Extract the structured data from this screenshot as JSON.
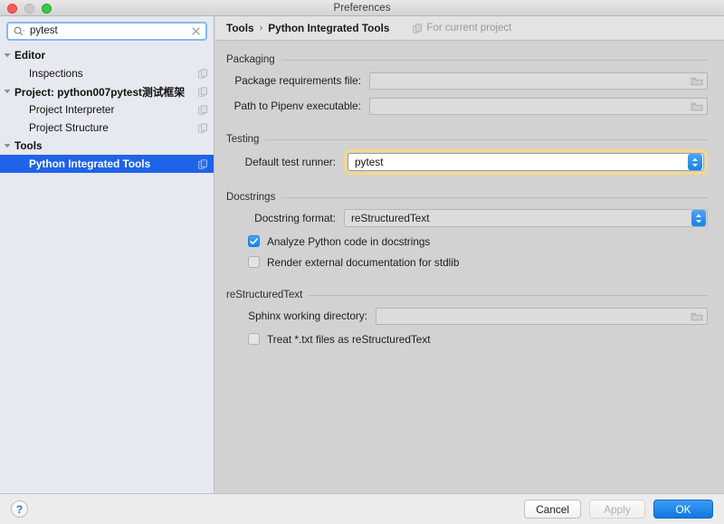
{
  "window": {
    "title": "Preferences",
    "traffic_lights": [
      "close-red",
      "minimize-disabled",
      "zoom-green"
    ]
  },
  "sidebar": {
    "search": {
      "value": "pytest",
      "placeholder": "",
      "icon": "search-icon",
      "clear_icon": "clear-icon"
    },
    "tree": [
      {
        "label": "Editor",
        "type": "group",
        "expanded": true,
        "selected": false,
        "scope_icon": false
      },
      {
        "label": "Inspections",
        "type": "child",
        "expanded": false,
        "selected": false,
        "scope_icon": true
      },
      {
        "label": "Project: python007pytest测试框架",
        "type": "group",
        "expanded": true,
        "selected": false,
        "scope_icon": true
      },
      {
        "label": "Project Interpreter",
        "type": "child",
        "expanded": false,
        "selected": false,
        "scope_icon": true
      },
      {
        "label": "Project Structure",
        "type": "child",
        "expanded": false,
        "selected": false,
        "scope_icon": true
      },
      {
        "label": "Tools",
        "type": "group",
        "expanded": true,
        "selected": false,
        "scope_icon": false
      },
      {
        "label": "Python Integrated Tools",
        "type": "child",
        "expanded": false,
        "selected": true,
        "scope_icon": true
      }
    ]
  },
  "main": {
    "breadcrumb": {
      "parent": "Tools",
      "separator": "›",
      "current": "Python Integrated Tools"
    },
    "scope_note": "For current project",
    "sections": [
      {
        "title": "Packaging",
        "fields": [
          {
            "label": "Package requirements file:",
            "value": "",
            "control": "textfield",
            "browse": true,
            "disabled": true
          },
          {
            "label": "Path to Pipenv executable:",
            "value": "",
            "control": "textfield",
            "browse": true,
            "disabled": true
          }
        ]
      },
      {
        "title": "Testing",
        "fields": [
          {
            "label": "Default test runner:",
            "value": "pytest",
            "control": "combo",
            "highlighted": true
          }
        ]
      },
      {
        "title": "Docstrings",
        "fields": [
          {
            "label": "Docstring format:",
            "value": "reStructuredText",
            "control": "combo",
            "highlighted": false
          }
        ],
        "checkboxes": [
          {
            "label": "Analyze Python code in docstrings",
            "checked": true
          },
          {
            "label": "Render external documentation for stdlib",
            "checked": false
          }
        ]
      },
      {
        "title": "reStructuredText",
        "fields": [
          {
            "label": "Sphinx working directory:",
            "value": "",
            "control": "textfield",
            "browse": true,
            "disabled": true
          }
        ],
        "checkboxes": [
          {
            "label": "Treat *.txt files as reStructuredText",
            "checked": false
          }
        ]
      }
    ]
  },
  "footer": {
    "help_label": "?",
    "cancel_label": "Cancel",
    "apply_label": "Apply",
    "ok_label": "OK"
  },
  "colors": {
    "selection_blue": "#1f63e8",
    "primary_blue": "#1078e2",
    "highlight_gold": "#f3d98a",
    "sidebar_bg": "#e6e9ef",
    "panel_bg": "#d2d2d2"
  }
}
